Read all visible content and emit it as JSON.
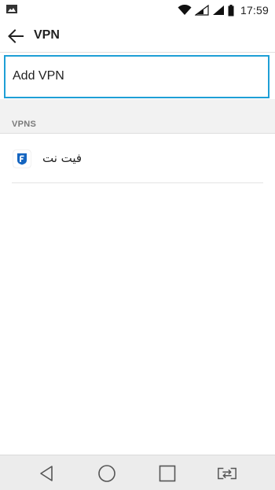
{
  "status_bar": {
    "time": "17:59",
    "icons": [
      "gallery-icon",
      "wifi-icon",
      "signal-icon",
      "signal-icon",
      "battery-icon"
    ]
  },
  "app_bar": {
    "title": "VPN",
    "back_icon": "arrow-left-icon"
  },
  "add_vpn": {
    "label": "Add VPN"
  },
  "section": {
    "header": "VPNS"
  },
  "vpn_list": [
    {
      "name": "فیت نت",
      "icon": "app-f-icon"
    }
  ],
  "nav_bar": {
    "icons": [
      "back-triangle-icon",
      "home-circle-icon",
      "recents-square-icon",
      "dual-window-icon"
    ]
  },
  "colors": {
    "focus_border": "#1e9fd6",
    "section_background": "#f2f2f2",
    "nav_background": "#ececec",
    "app_icon_blue": "#1565c0"
  }
}
